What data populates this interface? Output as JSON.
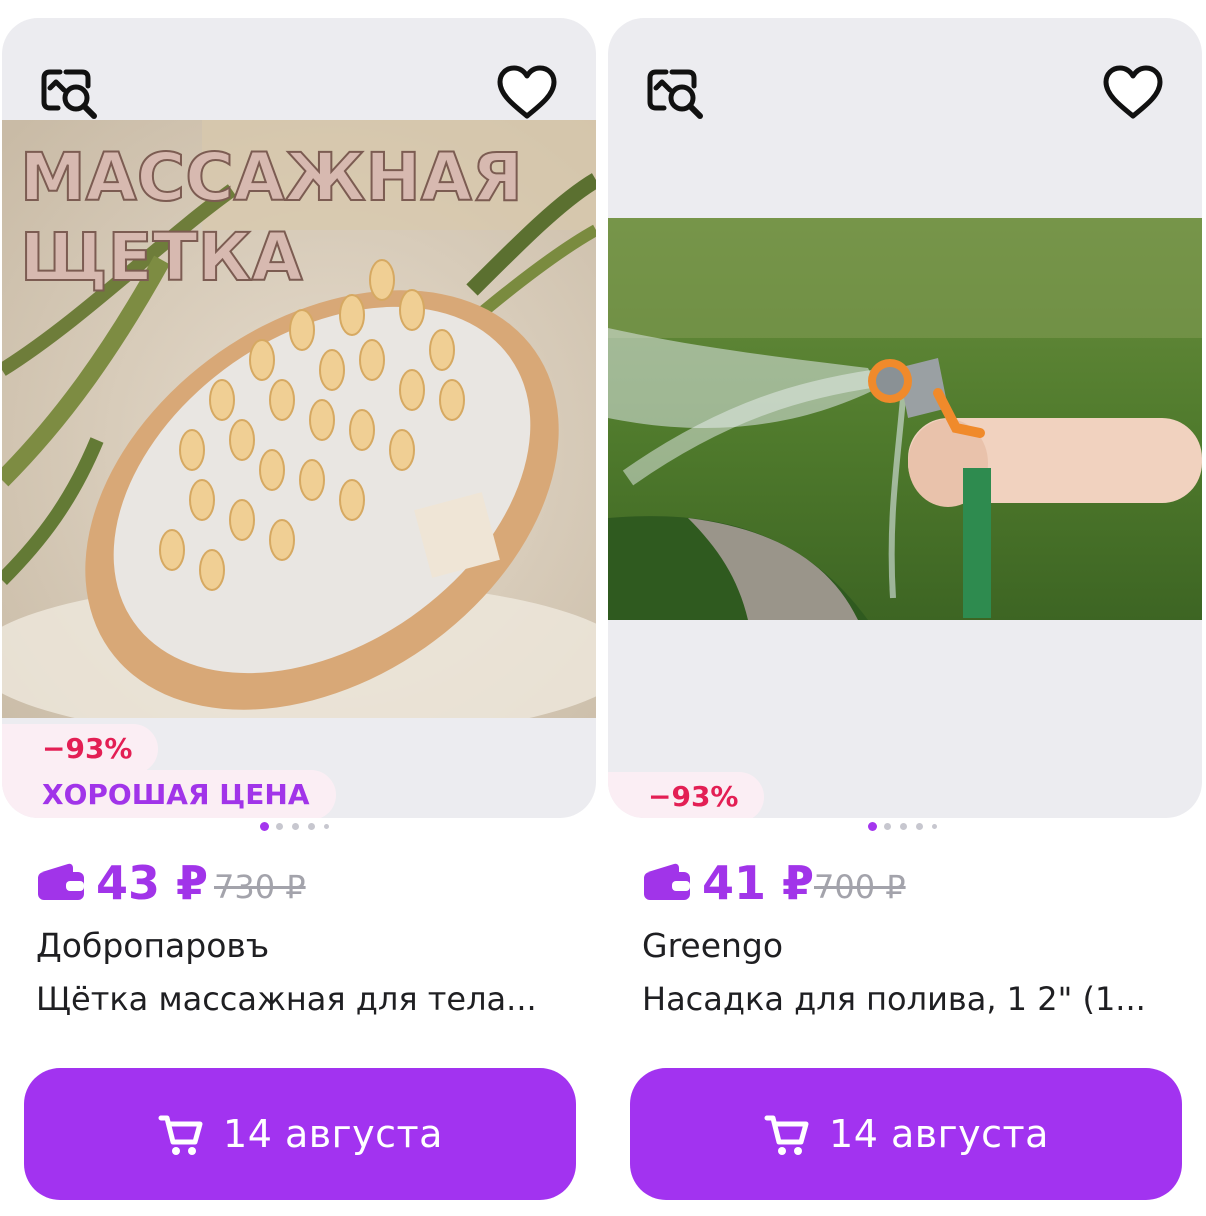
{
  "colors": {
    "accent": "#a233f0",
    "discount": "#e31f54",
    "card_bg": "#ececf0",
    "text": "#1f1f22",
    "old_price": "#a3a3ab"
  },
  "icons": {
    "similar": "image-search-icon",
    "favorite": "heart-icon",
    "wallet": "wallet-icon",
    "cart": "cart-icon"
  },
  "products": [
    {
      "image_text_line1": "МАССАЖНАЯ",
      "image_text_line2": "ЩЕТКА",
      "discount": "−93%",
      "label": "ХОРОШАЯ ЦЕНА",
      "carousel": {
        "count": 5,
        "active": 1
      },
      "price": "43 ₽",
      "old_price": "730 ₽",
      "brand": "Добропаровъ",
      "title": "Щётка массажная для тела...",
      "delivery": "14 августа"
    },
    {
      "discount": "−93%",
      "carousel": {
        "count": 5,
        "active": 1
      },
      "price": "41 ₽",
      "old_price": "700 ₽",
      "brand": "Greengo",
      "title": "Насадка для полива, 1 2\" (1...",
      "delivery": "14 августа"
    }
  ]
}
